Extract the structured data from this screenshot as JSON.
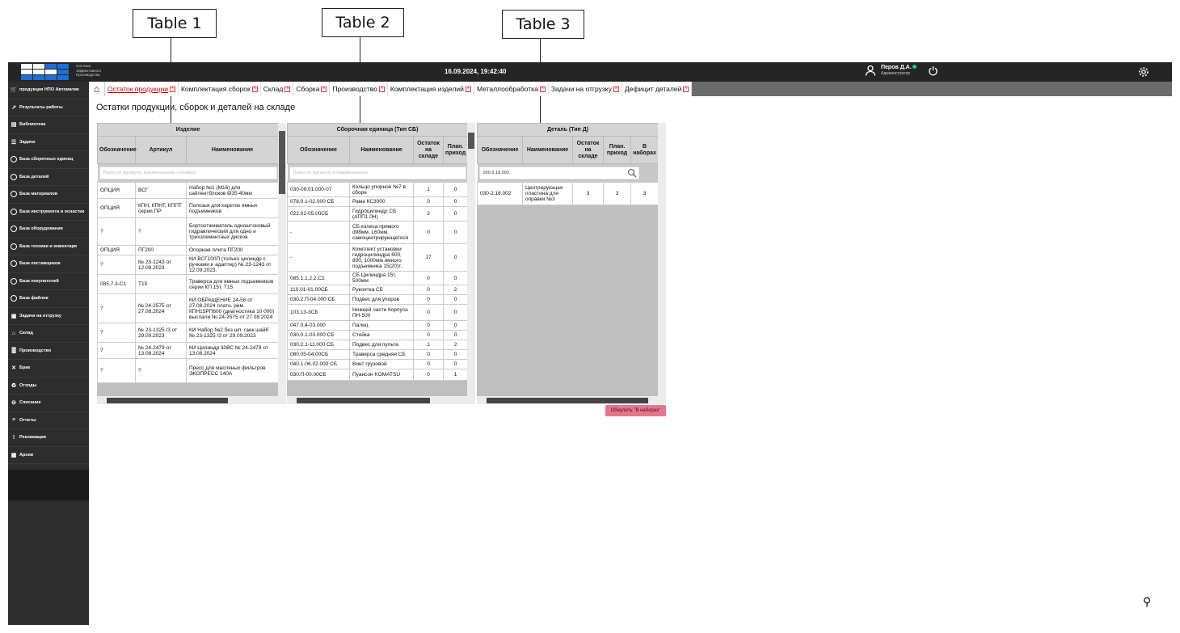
{
  "annotations": [
    "Table 1",
    "Table 2",
    "Table 3"
  ],
  "header": {
    "logo_lines": [
      "Система",
      "Эффективного",
      "Производства"
    ],
    "datetime": "16.09.2024, 19:42:40",
    "user_name": "Перов Д.А.",
    "user_role": "Администратор"
  },
  "sidebar": {
    "items": [
      {
        "label": "продукция НПО Автоматик",
        "icon": "cart-icon"
      },
      {
        "label": "Результаты работы",
        "icon": "rocket-icon"
      },
      {
        "label": "Библиотека",
        "icon": "library-icon"
      },
      {
        "label": "Задачи",
        "icon": "tasks-icon"
      },
      {
        "label": "База сборочных единиц",
        "icon": "database-icon"
      },
      {
        "label": "База деталей",
        "icon": "database-icon"
      },
      {
        "label": "База материалов",
        "icon": "database-icon"
      },
      {
        "label": "База инструмента и оснастки",
        "icon": "database-icon"
      },
      {
        "label": "База оборудования",
        "icon": "database-icon"
      },
      {
        "label": "База техники и инвентаря",
        "icon": "database-icon"
      },
      {
        "label": "База поставщиков",
        "icon": "database-icon"
      },
      {
        "label": "База покупателей",
        "icon": "database-icon"
      },
      {
        "label": "База файлов",
        "icon": "database-icon"
      },
      {
        "label": "Задачи на отгрузку",
        "icon": "shipping-icon"
      },
      {
        "label": "Склад",
        "icon": "warehouse-icon"
      },
      {
        "label": "Производство",
        "icon": "factory-icon"
      },
      {
        "label": "Брак",
        "icon": "defect-icon"
      },
      {
        "label": "Отходы",
        "icon": "recycle-icon"
      },
      {
        "label": "Списание",
        "icon": "writeoff-icon"
      },
      {
        "label": "Отчеты",
        "icon": "report-icon"
      },
      {
        "label": "Рекламация",
        "icon": "complaint-icon"
      },
      {
        "label": "Архив",
        "icon": "archive-icon"
      }
    ]
  },
  "tabs": [
    {
      "label": "Остаток продукции",
      "active": true
    },
    {
      "label": "Комплектация сборок"
    },
    {
      "label": "Склад"
    },
    {
      "label": "Сборка"
    },
    {
      "label": "Производство"
    },
    {
      "label": "Комплектация изделий"
    },
    {
      "label": "Металлообработка"
    },
    {
      "label": "Задачи на отгрузку"
    },
    {
      "label": "Дефицит деталей"
    }
  ],
  "page_title": "Остатки продукции, сборок и деталей на складе",
  "table1": {
    "group": "Изделие",
    "columns": [
      "Обозначение",
      "Артикул",
      "Наименование"
    ],
    "search_placeholder": "Поиск по Артикулу, Наименованию и Номеру",
    "rows": [
      [
        "ОПЦИЯ",
        "ВСГ",
        "Набор №1 (М16) для сайлентблоков Ø35-40мм"
      ],
      [
        "ОПЦИЯ",
        "КПН, КПНТ, КППТ серии ПР",
        "Полозья для кареток ямных подъемников"
      ],
      [
        "?",
        "?",
        "Бортоотжиматель одноштоковый гидравлический для одно и трехэлементных дисков"
      ],
      [
        "ОПЦИЯ",
        "ПГ200",
        "Опорная плита ПГ200"
      ],
      [
        "?",
        "№ 23-1243 от 12.09.2023",
        "КИ ВСГ100П (только цилиндр с ручками и адаптер) № 23-1243 от 12.09.2023."
      ],
      [
        "085.7.3-С1",
        "Т15",
        "Траверса для ямных подъемников серии КП 15т. Т15"
      ],
      [
        "?",
        "№ 24-2575 от 27.08.2024",
        "КИ ОБРАЩЕНИЕ 24-58 от 27.08.2024 платн. рем. КПН15РП600 (диагностика 10 000) выслали № 24-2575 от 27.08.2024"
      ],
      [
        "?",
        "№ 23-1325 /3 от 29.09.2023",
        "КИ Набор №2 без шп. гаек шайб № 23-1325 /3 от 29.09.2023"
      ],
      [
        "?",
        "№ 24-2479 от 13.08.2024",
        "КИ Цилиндр 30ВС № 24-2479 от 13.08.2024"
      ],
      [
        "?",
        "?",
        "Пресс для масляных фильтров ЭКОПРЕСС 140А"
      ]
    ]
  },
  "table2": {
    "group": "Сборочная единица (Тип СБ)",
    "columns": [
      "Обозначение",
      "Наименование",
      "Остаток на складе",
      "План. приход"
    ],
    "search_placeholder": "Поиск по Артикулу и Наименованию",
    "rows": [
      [
        "030-09.01.000-07",
        "Кольцо упорное №7 в сборе",
        "1",
        "0"
      ],
      [
        "078.0.1-02.000 СБ",
        "Рама КС3000",
        "0",
        "0"
      ],
      [
        "022.01-05.00СБ",
        "Гидроцилиндр СБ (АПП1.0Н)",
        "2",
        "0"
      ],
      [
        "-",
        "СБ колеса прямого d98мм. L60мм. самоцентрирующегося",
        "0",
        "0"
      ],
      [
        "-",
        "Комплект установки гидроцилиндра 600, 800, 1000мм ямного подъемника 15(20)т.",
        "17",
        "0"
      ],
      [
        "085.1.1.2.2.С2",
        "СБ Цилиндра 15т. 500мм",
        "0",
        "0"
      ],
      [
        "110.01-01.00СБ",
        "Рукоятка СБ",
        "0",
        "2"
      ],
      [
        "030.2.П-04.000 СБ",
        "Подвес для упоров",
        "0",
        "0"
      ],
      [
        "103.13-3СБ",
        "Нижней части Корпуса ПН-500",
        "0",
        "0"
      ],
      [
        "047.0.4-03.000",
        "Палец",
        "0",
        "0"
      ],
      [
        "030.0.1-03.000 СБ",
        "Стойка",
        "0",
        "0"
      ],
      [
        "030.2.1-11.000 СБ",
        "Подвес для пульта",
        "1",
        "2"
      ],
      [
        "080.05-04.00СБ",
        "Траверса средняя СБ",
        "0",
        "0"
      ],
      [
        "040.1-06.02.000 СБ",
        "Винт грузовой",
        "0",
        "0"
      ],
      [
        "030.П-00.00СБ",
        "Пуансон KOMATSU",
        "0",
        "1"
      ]
    ]
  },
  "table3": {
    "group": "Деталь (Тип Д)",
    "columns": [
      "Обозначение",
      "Наименование",
      "Остаток на складе",
      "План. приход",
      "В наборах"
    ],
    "search_value": "030-2.18.002",
    "rows": [
      [
        "030-2.18.002",
        "Центрирующая пластина для оправки №3",
        "3",
        "3",
        "3"
      ]
    ]
  },
  "reset_button": "Обнулить \"В наборах\""
}
